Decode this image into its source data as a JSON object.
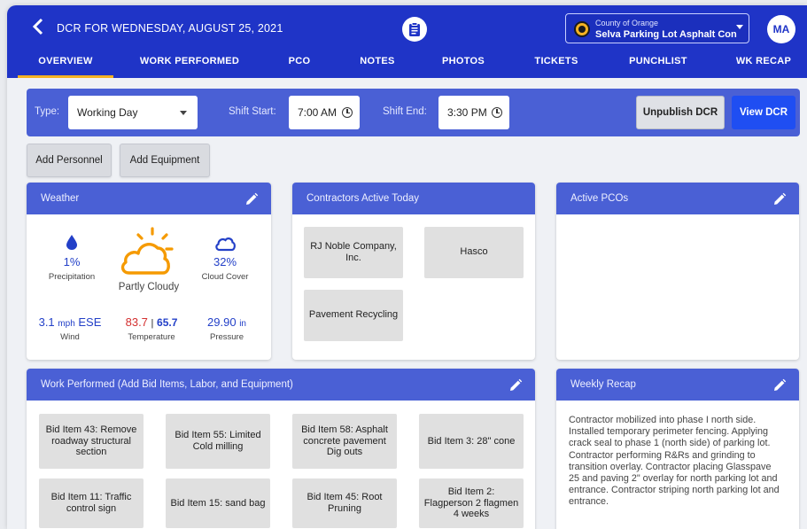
{
  "header": {
    "title": "DCR FOR WEDNESDAY, AUGUST 25, 2021",
    "project_county": "County of Orange",
    "project_name": "Selva Parking Lot Asphalt Concrete",
    "user_initials": "MA"
  },
  "tabs": [
    {
      "label": "OVERVIEW",
      "active": true
    },
    {
      "label": "WORK PERFORMED"
    },
    {
      "label": "PCO"
    },
    {
      "label": "NOTES"
    },
    {
      "label": "PHOTOS"
    },
    {
      "label": "TICKETS"
    },
    {
      "label": "PUNCHLIST"
    },
    {
      "label": "WK RECAP"
    }
  ],
  "shift": {
    "type_label": "Type:",
    "type_value": "Working Day",
    "start_label": "Shift Start:",
    "start_value": "7:00 AM",
    "end_label": "Shift End:",
    "end_value": "3:30 PM",
    "unpublish_label": "Unpublish DCR",
    "view_label": "View DCR"
  },
  "actions": {
    "add_personnel": "Add Personnel",
    "add_equipment": "Add Equipment"
  },
  "weather": {
    "title": "Weather",
    "precipitation_value": "1%",
    "precipitation_label": "Precipitation",
    "condition": "Partly Cloudy",
    "cloud_value": "32%",
    "cloud_label": "Cloud Cover",
    "wind_speed": "3.1",
    "wind_unit": "mph",
    "wind_dir": "ESE",
    "wind_label": "Wind",
    "temp_high": "83.7",
    "temp_sep": "|",
    "temp_low": "65.7",
    "temp_label": "Temperature",
    "pressure_value": "29.90",
    "pressure_unit": "in",
    "pressure_label": "Pressure"
  },
  "contractors": {
    "title": "Contractors Active Today",
    "items": [
      "RJ Noble Company, Inc.",
      "Hasco",
      "Pavement Recycling"
    ]
  },
  "pcos": {
    "title": "Active PCOs"
  },
  "work": {
    "title": "Work Performed (Add Bid Items, Labor, and Equipment)",
    "items": [
      "Bid Item 43: Remove roadway structural section",
      "Bid Item 55: Limited Cold milling",
      "Bid Item 58: Asphalt concrete pavement Dig outs",
      "Bid Item 3: 28\" cone",
      "Bid Item 11: Traffic control sign",
      "Bid Item 15: sand bag",
      "Bid Item 45: Root Pruning",
      "Bid Item 2: Flagperson 2 flagmen 4 weeks"
    ]
  },
  "recap": {
    "title": "Weekly Recap",
    "text": "Contractor mobilized into phase I north side. Installed temporary perimeter fencing. Applying crack seal to phase 1 (north side) of parking lot. Contractor performing R&Rs and grinding to transition overlay. Contractor placing Glasspave 25 and paving 2\" overlay for north parking lot and entrance. Contractor striping north parking lot and entrance."
  },
  "colors": {
    "primary": "#1f34c7",
    "card_header": "#4a60d5",
    "accent": "#f4b223",
    "temp_high": "#d32f2f"
  }
}
